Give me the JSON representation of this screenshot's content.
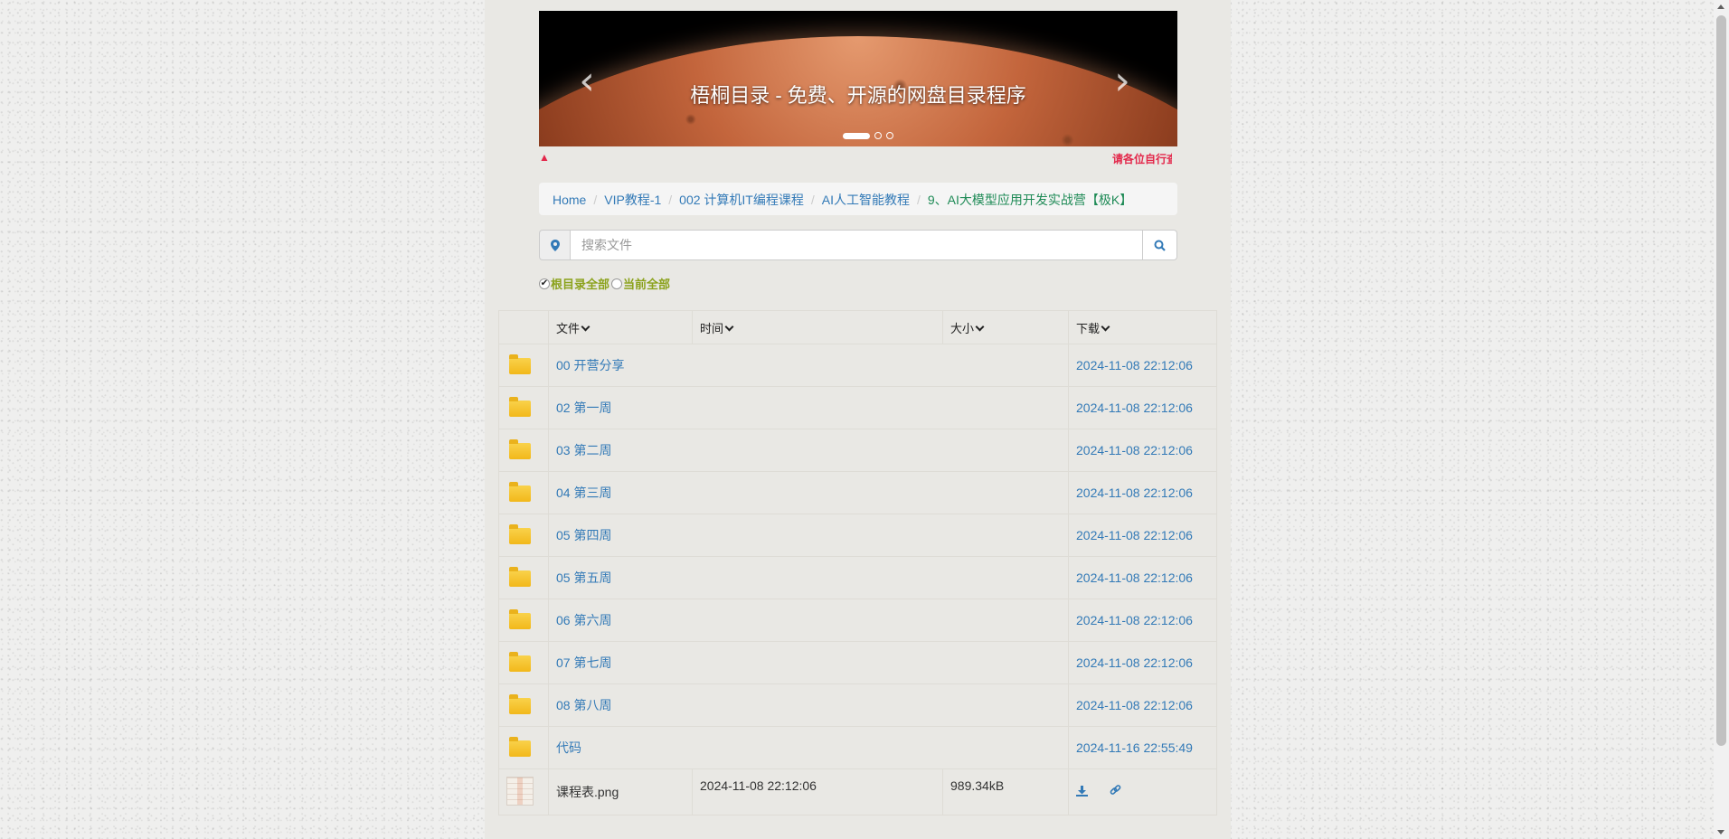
{
  "carousel": {
    "caption": "梧桐目录 - 免费、开源的网盘目录程序",
    "prev": "‹",
    "next": "›"
  },
  "notice": {
    "speaker": "🔈",
    "text": "请各位自行查"
  },
  "breadcrumb": {
    "items": [
      "Home",
      "VIP教程-1",
      "002 计算机IT编程课程",
      "AI人工智能教程"
    ],
    "current": "9、AI大模型应用开发实战营【极K】"
  },
  "search": {
    "placeholder": "搜索文件"
  },
  "scope": {
    "option1": "根目录全部",
    "option2": "当前全部",
    "selected": "option1"
  },
  "table": {
    "headers": [
      "文件",
      "时间",
      "大小",
      "下载"
    ],
    "folders": [
      {
        "name": "00 开营分享",
        "date": "2024-11-08 22:12:06"
      },
      {
        "name": "02 第一周",
        "date": "2024-11-08 22:12:06"
      },
      {
        "name": "03 第二周",
        "date": "2024-11-08 22:12:06"
      },
      {
        "name": "04 第三周",
        "date": "2024-11-08 22:12:06"
      },
      {
        "name": "05 第四周",
        "date": "2024-11-08 22:12:06"
      },
      {
        "name": "05 第五周",
        "date": "2024-11-08 22:12:06"
      },
      {
        "name": "06 第六周",
        "date": "2024-11-08 22:12:06"
      },
      {
        "name": "07 第七周",
        "date": "2024-11-08 22:12:06"
      },
      {
        "name": "08 第八周",
        "date": "2024-11-08 22:12:06"
      },
      {
        "name": "代码",
        "date": "2024-11-16 22:55:49"
      }
    ],
    "file": {
      "name": "课程表.png",
      "date": "2024-11-08 22:12:06",
      "size": "989.34kB"
    }
  },
  "colors": {
    "link": "#337ab7",
    "notice": "#e3274a",
    "scope": "#8ba21c",
    "breadcrumb_current": "#1e8a56"
  }
}
